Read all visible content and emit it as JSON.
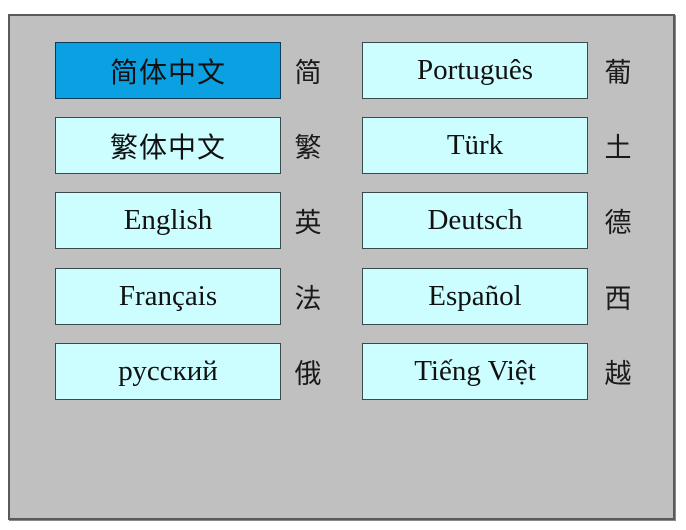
{
  "language_menu": {
    "selected": "简体中文",
    "left_column": [
      {
        "label": "简体中文",
        "short": "简",
        "selected": true
      },
      {
        "label": "繁体中文",
        "short": "繁",
        "selected": false
      },
      {
        "label": "English",
        "short": "英",
        "selected": false
      },
      {
        "label": "Français",
        "short": "法",
        "selected": false
      },
      {
        "label": "русский",
        "short": "俄",
        "selected": false
      }
    ],
    "right_column": [
      {
        "label": "Português",
        "short": "葡",
        "selected": false
      },
      {
        "label": "Türk",
        "short": "土",
        "selected": false
      },
      {
        "label": "Deutsch",
        "short": "德",
        "selected": false
      },
      {
        "label": "Español",
        "short": "西",
        "selected": false
      },
      {
        "label": "Tiếng Việt",
        "short": "越",
        "selected": false
      }
    ],
    "colors": {
      "panel_bg": "#c0c0c0",
      "button_bg": "#ccfeff",
      "selected_bg": "#0ba0e2"
    }
  }
}
